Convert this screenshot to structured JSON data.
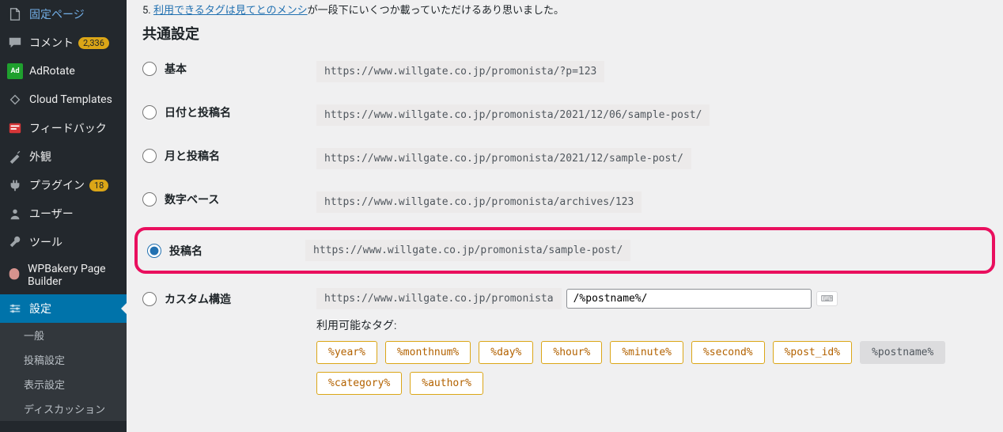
{
  "sidebar": {
    "pages": "固定ページ",
    "comments": "コメント",
    "comments_count": "2,336",
    "adrotate": "AdRotate",
    "adrotate_badge": "Ad",
    "cloudtemplates": "Cloud Templates",
    "feedback": "フィードバック",
    "appearance": "外観",
    "plugins": "プラグイン",
    "plugins_count": "18",
    "users": "ユーザー",
    "tools": "ツール",
    "wpbakery": "WPBakery Page Builder",
    "settings": "設定",
    "sub_general": "一般",
    "sub_writing": "投稿設定",
    "sub_reading": "表示設定",
    "sub_discussion": "ディスカッション"
  },
  "note": {
    "prefix": "5. ",
    "link": "利用できるタグは見てとのメンシ",
    "suffix": "が一段下にいくつか載っていただけるあり思いました。"
  },
  "heading": "共通設定",
  "opt": {
    "plain": "基本",
    "plain_sample": "https://www.willgate.co.jp/promonista/?p=123",
    "dayname": "日付と投稿名",
    "dayname_sample": "https://www.willgate.co.jp/promonista/2021/12/06/sample-post/",
    "monthname": "月と投稿名",
    "monthname_sample": "https://www.willgate.co.jp/promonista/2021/12/sample-post/",
    "numeric": "数字ベース",
    "numeric_sample": "https://www.willgate.co.jp/promonista/archives/123",
    "postname": "投稿名",
    "postname_sample": "https://www.willgate.co.jp/promonista/sample-post/",
    "custom": "カスタム構造",
    "custom_base": "https://www.willgate.co.jp/promonista",
    "custom_value": "/%postname%/",
    "tags_label": "利用可能なタグ:",
    "tags": [
      "%year%",
      "%monthnum%",
      "%day%",
      "%hour%",
      "%minute%",
      "%second%",
      "%post_id%",
      "%postname%",
      "%category%",
      "%author%"
    ],
    "selected_tag_index": 7
  }
}
